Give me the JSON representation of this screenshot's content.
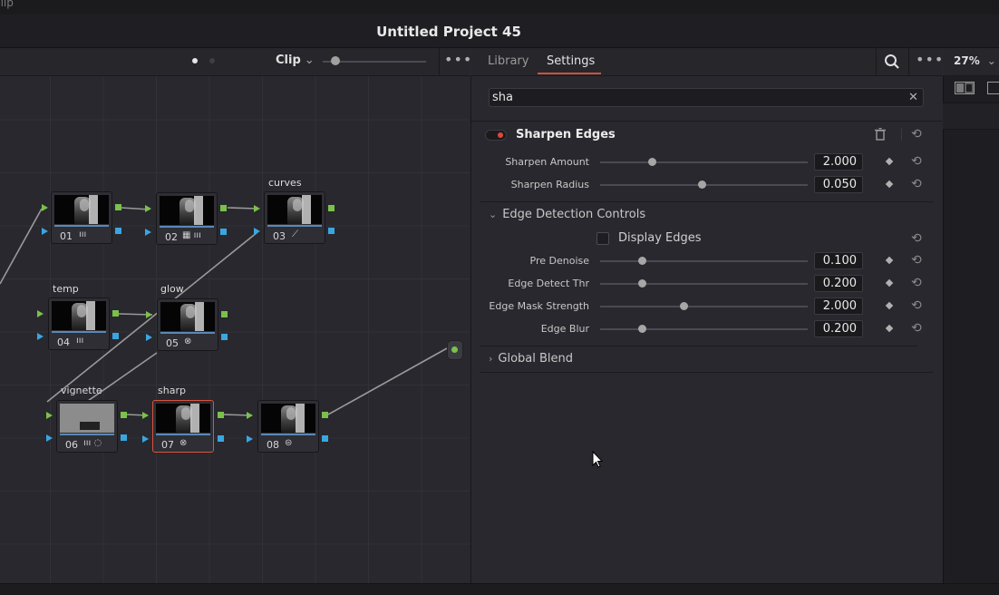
{
  "top": {
    "cut_label": "clip"
  },
  "title": "Untitled Project 45",
  "node_toolbar": {
    "mode": "Clip"
  },
  "nodes": [
    {
      "num": "01",
      "label": ""
    },
    {
      "num": "02",
      "label": ""
    },
    {
      "num": "03",
      "label": "curves"
    },
    {
      "num": "04",
      "label": "temp"
    },
    {
      "num": "05",
      "label": "glow"
    },
    {
      "num": "06",
      "label": "vignette"
    },
    {
      "num": "07",
      "label": "sharp"
    },
    {
      "num": "08",
      "label": ""
    }
  ],
  "panel": {
    "tabs": [
      "Library",
      "Settings"
    ],
    "active_tab": "Settings",
    "search": {
      "value": "sha"
    },
    "effect": {
      "name": "Sharpen Edges",
      "enabled": true,
      "params": [
        {
          "label": "Sharpen Amount",
          "value": "2.000",
          "level": 0.25
        },
        {
          "label": "Sharpen Radius",
          "value": "0.050",
          "level": 0.49
        }
      ],
      "edge_section": {
        "title": "Edge Detection Controls",
        "expanded": true,
        "display_edges": {
          "label": "Display Edges",
          "checked": false
        },
        "params": [
          {
            "label": "Pre Denoise",
            "value": "0.100",
            "level": 0.2
          },
          {
            "label": "Edge Detect Thr",
            "value": "0.200",
            "level": 0.2
          },
          {
            "label": "Edge Mask Strength",
            "value": "2.000",
            "level": 0.4
          },
          {
            "label": "Edge Blur",
            "value": "0.200",
            "level": 0.2
          }
        ]
      },
      "global_blend": {
        "title": "Global Blend",
        "expanded": false
      }
    }
  },
  "viewer": {
    "zoom": "27%"
  },
  "colors": {
    "accent": "#d0503c",
    "input_port": "#7ac14a",
    "output_port": "#3aa6e0"
  },
  "icons": [
    "search-icon",
    "more-icon",
    "trash-icon",
    "reset-icon",
    "keyframe-icon",
    "chevron-down-icon",
    "chevron-right-icon",
    "close-icon"
  ]
}
